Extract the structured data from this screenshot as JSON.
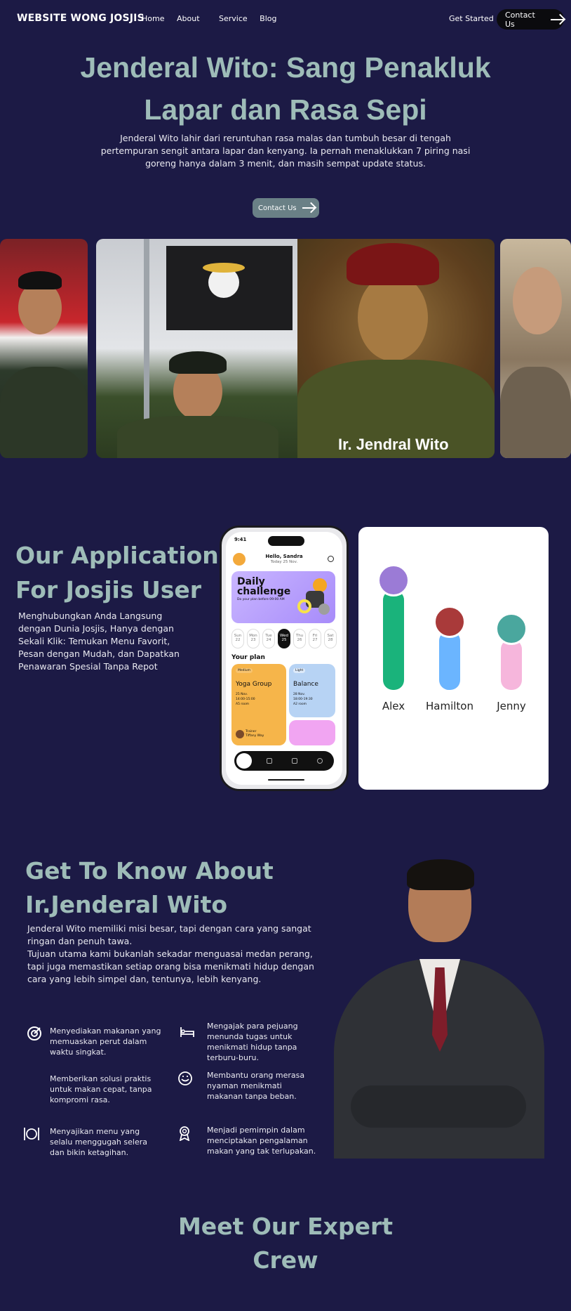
{
  "nav": {
    "brand": "WEBSITE WONG JOSJIS",
    "links": [
      "Home",
      "About",
      "Service",
      "Blog"
    ],
    "get_started": "Get Started",
    "contact": "Contact Us"
  },
  "hero": {
    "title_line1": "Jenderal Wito: Sang Penakluk",
    "title_line2": "Lapar dan Rasa Sepi",
    "text": "Jenderal Wito lahir dari reruntuhan rasa malas dan tumbuh besar di tengah pertempuran sengit antara lapar dan kenyang. Ia pernah menaklukkan 7 piring nasi goreng hanya dalam 3 menit, dan masih sempat update status.",
    "button": "Contact Us"
  },
  "gallery": {
    "caption": "Ir. Jendral Wito"
  },
  "application": {
    "title_line1": "Our Application",
    "title_line2": "For Josjis User",
    "text": "Menghubungkan Anda Langsung dengan Dunia Josjis, Hanya dengan Sekali Klik: Temukan Menu Favorit, Pesan dengan Mudah, dan Dapatkan Penawaran Spesial Tanpa Repot"
  },
  "phone": {
    "time": "9:41",
    "greeting": "Hello, Sandra",
    "date": "Today 25 Nov.",
    "challenge_title": "Daily challenge",
    "challenge_sub": "Do your plan before 09:00 AM",
    "days": [
      {
        "d": "Sun",
        "n": "22"
      },
      {
        "d": "Mon",
        "n": "23"
      },
      {
        "d": "Tue",
        "n": "24"
      },
      {
        "d": "Wed",
        "n": "25"
      },
      {
        "d": "Thu",
        "n": "26"
      },
      {
        "d": "Fri",
        "n": "27"
      },
      {
        "d": "Sat",
        "n": "28"
      }
    ],
    "your_plan": "Your plan",
    "yoga": {
      "tag": "Medium",
      "name": "Yoga Group",
      "date": "25 Nov.",
      "time": "14:00-15:00",
      "room": "A5 room",
      "trainer_label": "Trainer",
      "trainer": "Tiffany Way"
    },
    "balance": {
      "tag": "Light",
      "name": "Balance",
      "date": "28 Nov.",
      "time": "18:00-19:30",
      "room": "A2 room"
    }
  },
  "leaderboard": {
    "names": [
      "Alex",
      "Hamilton",
      "Jenny"
    ],
    "colors": [
      "#1ab37b",
      "#6bb5ff",
      "#f6b6dc"
    ]
  },
  "about": {
    "title_line1": "Get To Know About",
    "title_line2": "Ir.Jenderal Wito",
    "text": "Jenderal Wito memiliki misi besar, tapi dengan cara yang sangat ringan dan penuh tawa.\n Tujuan utama kami bukanlah sekadar menguasai medan perang, tapi juga memastikan setiap orang bisa menikmati hidup dengan cara yang lebih simpel dan, tentunya, lebih kenyang.",
    "features": [
      "Menyediakan makanan yang memuaskan perut dalam waktu singkat.",
      "Mengajak para pejuang menunda tugas untuk menikmati hidup tanpa terburu-buru.",
      "Memberikan solusi praktis untuk makan cepat, tanpa kompromi rasa.",
      "Membantu orang merasa nyaman menikmati makanan tanpa beban.",
      "Menyajikan menu yang selalu menggugah selera dan bikin ketagihan.",
      "Menjadi pemimpin dalam menciptakan pengalaman makan yang tak terlupakan."
    ]
  },
  "crew": {
    "title_line1": "Meet Our Expert",
    "title_line2": "Crew"
  }
}
